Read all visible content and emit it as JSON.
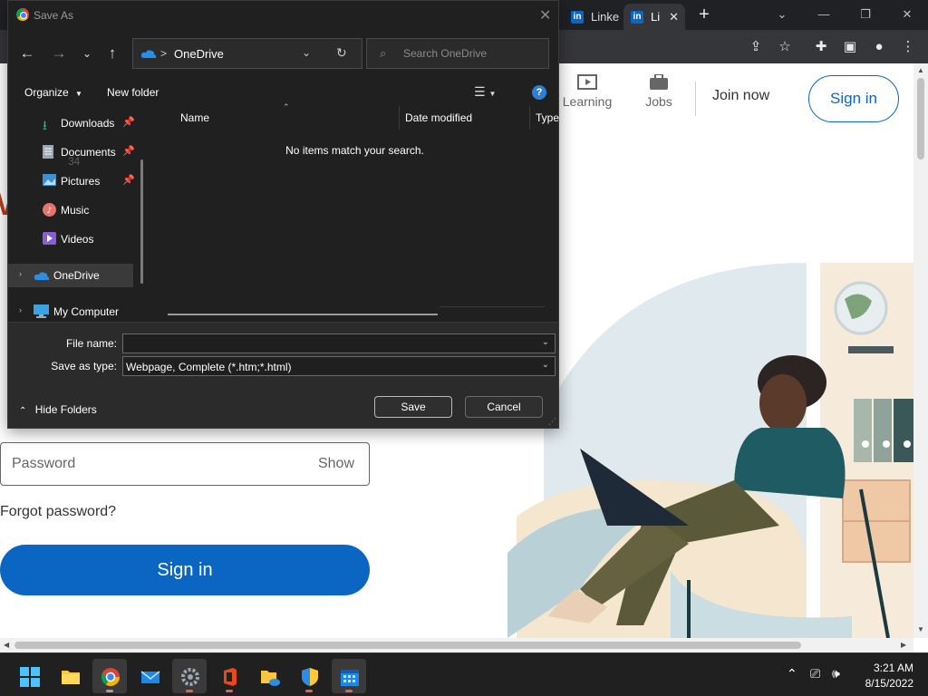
{
  "browser": {
    "tabs": [
      {
        "label": "Linke"
      },
      {
        "label": "Li"
      }
    ],
    "tab_close": "✕",
    "new_tab": "+"
  },
  "linkedin": {
    "nav": {
      "learning": "Learning",
      "jobs": "Jobs",
      "join": "Join now",
      "signin": "Sign in"
    },
    "password_label": "Password",
    "show_label": "Show",
    "forgot": "Forgot password?",
    "signin_button": "Sign in"
  },
  "dialog": {
    "title": "Save As",
    "address": {
      "separator": ">",
      "location": "OneDrive"
    },
    "search_placeholder": "Search OneDrive",
    "organize": "Organize",
    "new_folder": "New folder",
    "tree": [
      {
        "label": "Downloads",
        "pinned": true
      },
      {
        "label": "Documents",
        "pinned": true
      },
      {
        "label": "Pictures",
        "pinned": true
      },
      {
        "label": "Music"
      },
      {
        "label": "Videos"
      },
      {
        "label": "OneDrive",
        "selected": true
      },
      {
        "label": "My Computer"
      }
    ],
    "columns": {
      "name": "Name",
      "date": "Date modified",
      "type": "Type"
    },
    "empty_message": "No items match your search.",
    "file_name_label": "File name:",
    "file_name_value": "",
    "save_type_label": "Save as type:",
    "save_type_value": "Webpage, Complete (*.htm;*.html)",
    "hide_folders": "Hide Folders",
    "save_button": "Save",
    "cancel_button": "Cancel",
    "ghost_text": "34"
  },
  "taskbar": {
    "time": "3:21 AM",
    "date": "8/15/2022"
  },
  "colors": {
    "linkedin_blue": "#0a66c2",
    "dialog_bg": "#202020",
    "taskbar_bg": "#202020"
  }
}
